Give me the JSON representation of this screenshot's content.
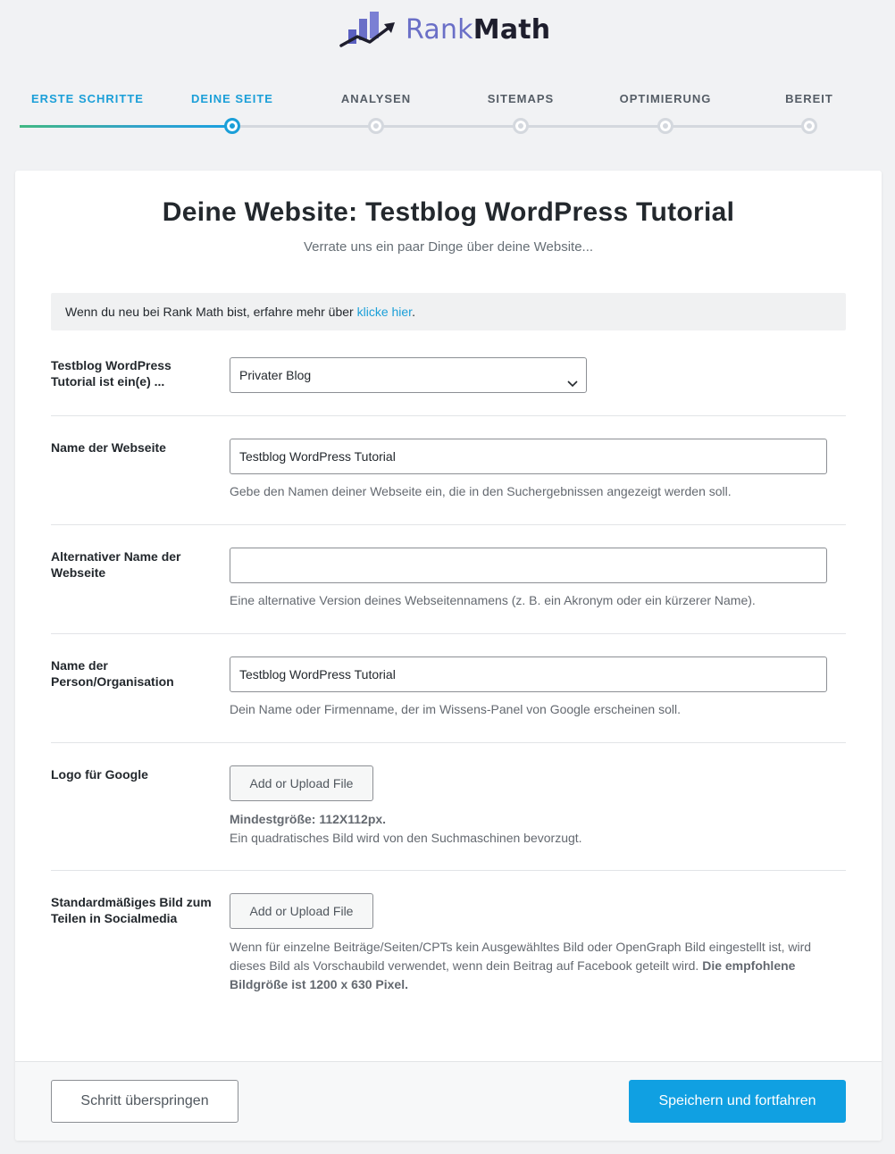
{
  "brand": {
    "name_part1": "Rank",
    "name_part2": "Math"
  },
  "stepper": {
    "steps": [
      {
        "label": "ERSTE SCHRITTE",
        "state": "done"
      },
      {
        "label": "DEINE SEITE",
        "state": "active"
      },
      {
        "label": "ANALYSEN",
        "state": "pending"
      },
      {
        "label": "SITEMAPS",
        "state": "pending"
      },
      {
        "label": "OPTIMIERUNG",
        "state": "pending"
      },
      {
        "label": "BEREIT",
        "state": "pending"
      }
    ]
  },
  "card": {
    "title": "Deine Website: Testblog WordPress Tutorial",
    "subtitle": "Verrate uns ein paar Dinge über deine Website..."
  },
  "notice": {
    "text": "Wenn du neu bei Rank Math bist, erfahre mehr über ",
    "link": "klicke hier",
    "suffix": "."
  },
  "form": {
    "site_type": {
      "label": "Testblog WordPress Tutorial ist ein(e) ...",
      "selected": "Privater Blog"
    },
    "site_name": {
      "label": "Name der Webseite",
      "value": "Testblog WordPress Tutorial",
      "description": "Gebe den Namen deiner Webseite ein, die in den Suchergebnissen angezeigt werden soll."
    },
    "alt_name": {
      "label": "Alternativer Name der Webseite",
      "value": "",
      "description": "Eine alternative Version deines Webseitennamens (z. B. ein Akronym oder ein kürzerer Name)."
    },
    "person_org": {
      "label": "Name der Person/Organisation",
      "value": "Testblog WordPress Tutorial",
      "description": "Dein Name oder Firmenname, der im Wissens-Panel von Google erscheinen soll."
    },
    "logo": {
      "label": "Logo für Google",
      "button": "Add or Upload File",
      "min_size": "Mindestgröße: 112X112px.",
      "description": "Ein quadratisches Bild wird von den Suchmaschinen bevorzugt."
    },
    "social_image": {
      "label": "Standardmäßiges Bild zum Teilen in Socialmedia",
      "button": "Add or Upload File",
      "description": "Wenn für einzelne Beiträge/Seiten/CPTs kein Ausgewähltes Bild oder OpenGraph Bild eingestellt ist, wird dieses Bild als Vorschaubild verwendet, wenn dein Beitrag auf Facebook geteilt wird. ",
      "description_bold": "Die empfohlene Bildgröße ist 1200 x 630 Pixel."
    }
  },
  "footer": {
    "skip_label": "Schritt überspringen",
    "save_label": "Speichern und fortfahren"
  },
  "colors": {
    "accent": "#1b9fd8",
    "primary_button": "#10a0e2",
    "brand_purple": "#6a6fc7"
  }
}
